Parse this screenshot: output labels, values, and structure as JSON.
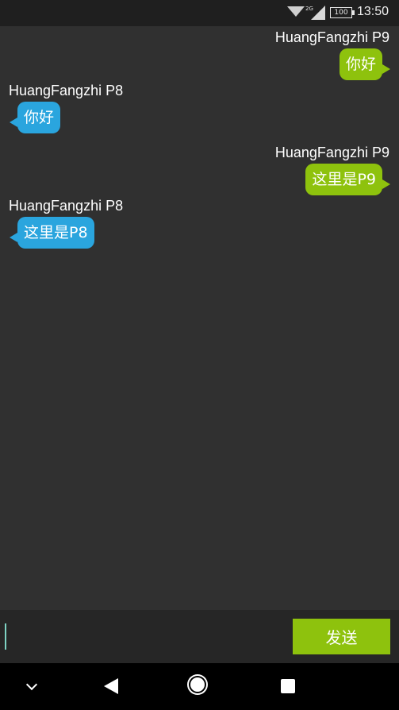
{
  "status_bar": {
    "network_type": "2G",
    "battery": "100",
    "time": "13:50",
    "icons": [
      "wifi-icon",
      "cell-signal-icon",
      "battery-icon"
    ]
  },
  "messages": [
    {
      "sender": "HuangFangzhi P9",
      "text": "你好",
      "direction": "outgoing"
    },
    {
      "sender": "HuangFangzhi P8",
      "text": "你好",
      "direction": "incoming"
    },
    {
      "sender": "HuangFangzhi P9",
      "text": "这里是P9",
      "direction": "outgoing"
    },
    {
      "sender": "HuangFangzhi P8",
      "text": "这里是P8",
      "direction": "incoming"
    }
  ],
  "input_bar": {
    "value": "",
    "send_label": "发送"
  },
  "nav_bar": {
    "icons": [
      "chevron-down-icon",
      "back-icon",
      "home-icon",
      "recents-icon"
    ]
  },
  "colors": {
    "background": "#303030",
    "outgoing_bubble": "#8ec20d",
    "incoming_bubble": "#2aa5de",
    "send_button": "#8ec20d"
  }
}
